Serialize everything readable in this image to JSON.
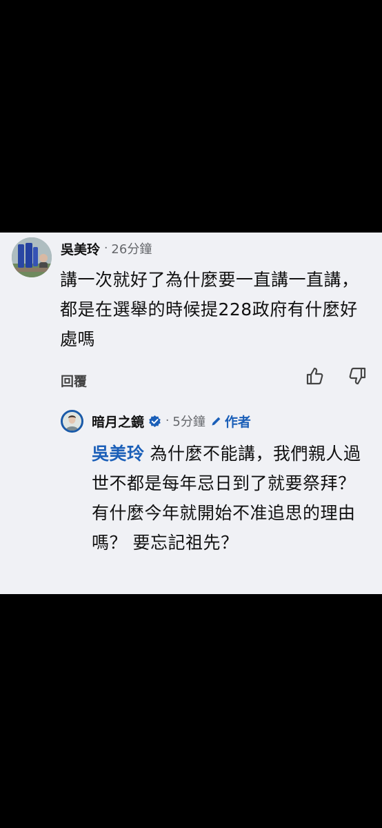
{
  "comment": {
    "author": "吳美玲",
    "separator": "·",
    "time": "26分鐘",
    "text": "講一次就好了為什麼要一直講一直講，都是在選舉的時候提228政府有什麼好處嗎",
    "reply_label": "回覆",
    "like_icon": "thumbs-up-icon",
    "dislike_icon": "thumbs-down-icon"
  },
  "reply": {
    "author": "暗月之鏡",
    "separator": "·",
    "time": "5分鐘",
    "author_badge": "作者",
    "mention": "吳美玲",
    "text": "為什麼不能講，我們親人過世不都是每年忌日到了就要祭拜？ 有什麼今年就開始不准追思的理由嗎？  要忘記祖先？",
    "verified_icon": "verified-badge-icon",
    "badge_icon": "pencil-icon"
  },
  "colors": {
    "panel_bg": "#f0f1f5",
    "link_blue": "#1b5fb8",
    "meta_gray": "#65676b",
    "text": "#111111"
  }
}
